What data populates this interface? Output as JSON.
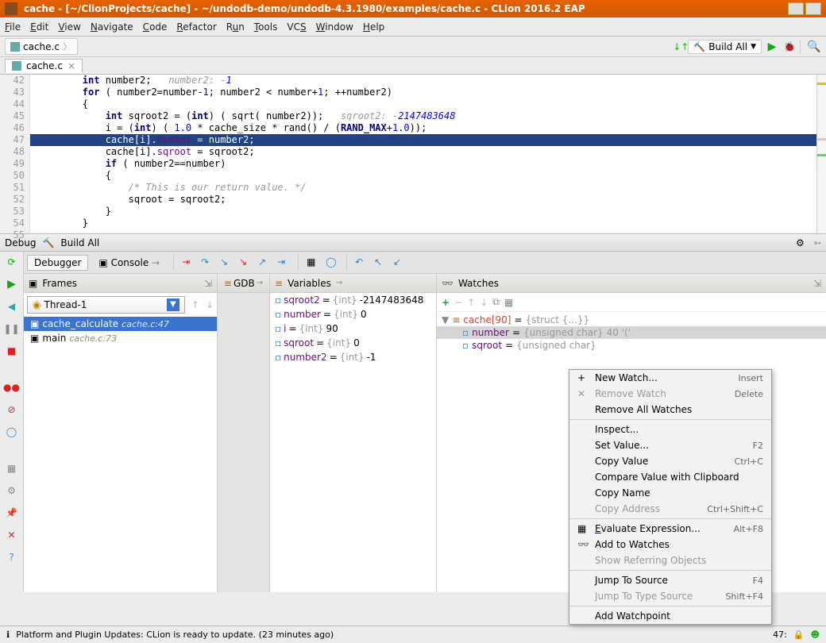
{
  "window": {
    "title": "cache - [~/ClionProjects/cache] - ~/undodb-demo/undodb-4.3.1980/examples/cache.c - CLion 2016.2 EAP"
  },
  "menu": [
    "File",
    "Edit",
    "View",
    "Navigate",
    "Code",
    "Refactor",
    "Run",
    "Tools",
    "VCS",
    "Window",
    "Help"
  ],
  "breadcrumb": {
    "file": "cache.c"
  },
  "toolbar": {
    "build_label": "Build All"
  },
  "file_tab": "cache.c",
  "gutter_start": 42,
  "code_lines": [
    "        int number2;   number2: -1",
    "        for ( number2=number-1; number2 < number+1; ++number2)",
    "        {",
    "            int sqroot2 = (int) ( sqrt( number2));   sqroot2: -2147483648",
    "            i = (int) ( 1.0 * cache_size * rand() / (RAND_MAX+1.0));",
    "            cache[i].number = number2;",
    "            cache[i].sqroot = sqroot2;",
    "            if ( number2==number)",
    "            {",
    "                /* This is our return value. */",
    "                sqroot = sqroot2;",
    "            }",
    "        }",
    ""
  ],
  "highlight_line_index": 5,
  "debug_header": {
    "left": "Debug",
    "build": "Build All"
  },
  "debugger_tabs": {
    "debugger": "Debugger",
    "console": "Console",
    "gdb": "GDB"
  },
  "panels": {
    "frames": "Frames",
    "variables": "Variables",
    "watches": "Watches"
  },
  "thread": "Thread-1",
  "frames": [
    {
      "fn": "cache_calculate",
      "loc": "cache.c:47",
      "sel": true
    },
    {
      "fn": "main",
      "loc": "cache.c:73",
      "sel": false
    }
  ],
  "variables": [
    {
      "name": "sqroot2",
      "type": "{int}",
      "val": "-2147483648"
    },
    {
      "name": "number",
      "type": "{int}",
      "val": "0"
    },
    {
      "name": "i",
      "type": "{int}",
      "val": "90"
    },
    {
      "name": "sqroot",
      "type": "{int}",
      "val": "0"
    },
    {
      "name": "number2",
      "type": "{int}",
      "val": "-1"
    }
  ],
  "watches": {
    "root": {
      "expr": "cache[90]",
      "type": "{struct {...}}"
    },
    "children": [
      {
        "name": "number",
        "type": "{unsigned char}",
        "val": "40 '('"
      },
      {
        "name": "sqroot",
        "type": "{unsigned char}",
        "val": ""
      }
    ]
  },
  "context_menu": [
    {
      "label": "New Watch...",
      "shortcut": "Insert",
      "icon": "plus"
    },
    {
      "label": "Remove Watch",
      "shortcut": "Delete",
      "icon": "x",
      "disabled": true
    },
    {
      "label": "Remove All Watches"
    },
    {
      "sep": true
    },
    {
      "label": "Inspect..."
    },
    {
      "label": "Set Value...",
      "shortcut": "F2"
    },
    {
      "label": "Copy Value",
      "shortcut": "Ctrl+C"
    },
    {
      "label": "Compare Value with Clipboard"
    },
    {
      "label": "Copy Name"
    },
    {
      "label": "Copy Address",
      "shortcut": "Ctrl+Shift+C",
      "disabled": true
    },
    {
      "sep": true
    },
    {
      "label": "Evaluate Expression...",
      "shortcut": "Alt+F8",
      "u": 0,
      "icon": "calc"
    },
    {
      "label": "Add to Watches",
      "icon": "glasses"
    },
    {
      "label": "Show Referring Objects",
      "disabled": true
    },
    {
      "sep": true
    },
    {
      "label": "Jump To Source",
      "shortcut": "F4"
    },
    {
      "label": "Jump To Type Source",
      "shortcut": "Shift+F4",
      "disabled": true
    },
    {
      "sep": true
    },
    {
      "label": "Add Watchpoint"
    }
  ],
  "status": {
    "msg": "Platform and Plugin Updates: CLion is ready to update. (23 minutes ago)",
    "pos": "47:"
  }
}
